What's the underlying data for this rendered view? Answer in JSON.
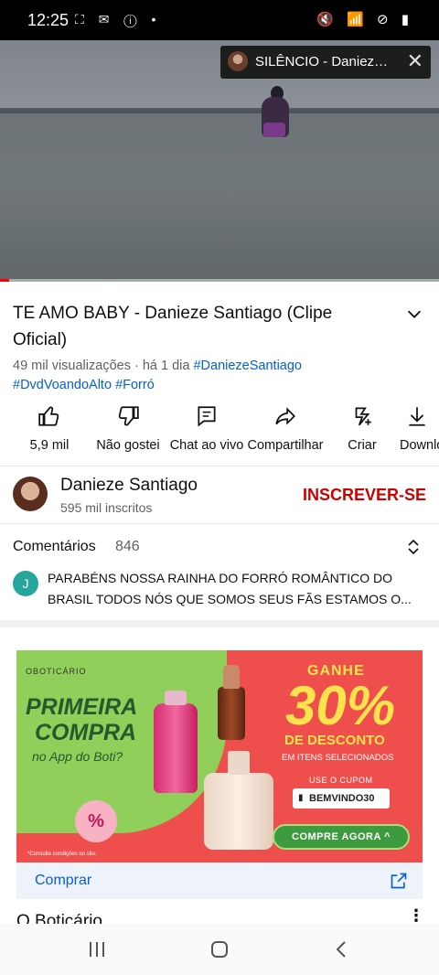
{
  "status_bar": {
    "time": "12:25",
    "left_icons": "⛶ ✉ ⓘ •",
    "right_icons": "🔇 📶 ⊘ ▮"
  },
  "miniplayer": {
    "title": "SILÊNCIO - Danieze Santiago"
  },
  "video": {
    "progress_fraction": 0.02
  },
  "video_info": {
    "title": "TE AMO BABY - Danieze Santiago (Clipe Oficial)",
    "views": "49 mil visualizações",
    "date": "· há 1 dia",
    "tags": [
      "#DaniezeSantiago",
      "#DvdVoandoAlto",
      "#Forró"
    ]
  },
  "actions": {
    "like": "5,9 mil",
    "dislike": "Não gostei",
    "chat": "Chat ao vivo",
    "share": "Compartilhar",
    "create": "Criar",
    "download": "Download"
  },
  "channel": {
    "name": "Danieze Santiago",
    "subscribers": "595 mil inscritos",
    "subscribe_label": "INSCREVER-SE"
  },
  "comments": {
    "label": "Comentários",
    "count": "846",
    "top_avatar": "J",
    "top_comment": "PARABÉNS NOSSA RAINHA DO FORRÓ ROMÂNTICO DO BRASIL TODOS NÓS QUE SOMOS SEUS FÃS ESTAMOS O..."
  },
  "ad": {
    "brand": "OBOTICÁRIO",
    "headline_1": "PRIMEIRA",
    "headline_2": "COMPRA",
    "subheadline": "no App do Boti?",
    "percent_badge": "%",
    "fine_print": "*Consulte condições no site.",
    "ganhe": "GANHE",
    "discount": "30%",
    "discount_label": "DE DESCONTO",
    "items_label": "EM ITENS SELECIONADOS",
    "coupon_label": "USE O CUPOM",
    "coupon_code": "BEMVINDO30",
    "cta": "COMPRE AGORA ^",
    "buy_label": "Comprar",
    "advertiser": "O Boticário",
    "more": "⋮"
  },
  "colors": {
    "accent_red": "#cc0000",
    "link_blue": "#065fd4",
    "ad_green": "#8fcf5a",
    "ad_red": "#ef4f4c"
  }
}
